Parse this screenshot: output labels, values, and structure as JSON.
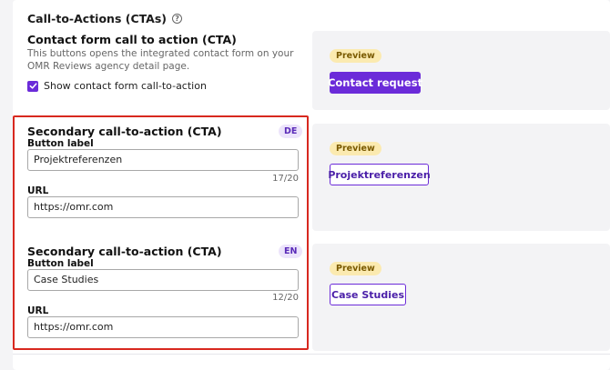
{
  "section": {
    "title": "Call-to-Actions (CTAs)",
    "info_icon": "?"
  },
  "contact_form": {
    "title": "Contact form call to action (CTA)",
    "description": "This buttons opens the integrated contact form on your OMR Reviews agency detail page.",
    "checkbox_label": "Show contact form call-to-action",
    "checkbox_checked": true,
    "preview_badge": "Preview",
    "preview_button": "Contact request"
  },
  "secondary_de": {
    "title": "Secondary call-to-action (CTA)",
    "lang": "DE",
    "button_label_label": "Button label",
    "button_label_value": "Projektreferenzen",
    "counter": "17/20",
    "url_label": "URL",
    "url_value": "https://omr.com",
    "preview_badge": "Preview",
    "preview_button": "Projektreferenzen"
  },
  "secondary_en": {
    "title": "Secondary call-to-action (CTA)",
    "lang": "EN",
    "button_label_label": "Button label",
    "button_label_value": "Case Studies",
    "counter": "12/20",
    "url_label": "URL",
    "url_value": "https://omr.com",
    "preview_badge": "Preview",
    "preview_button": "Case Studies"
  },
  "colors": {
    "accent": "#6b2bd9",
    "highlight_border": "#d8281f",
    "preview_badge_bg": "#fbeab0",
    "lang_badge_bg": "#ece4fb"
  }
}
